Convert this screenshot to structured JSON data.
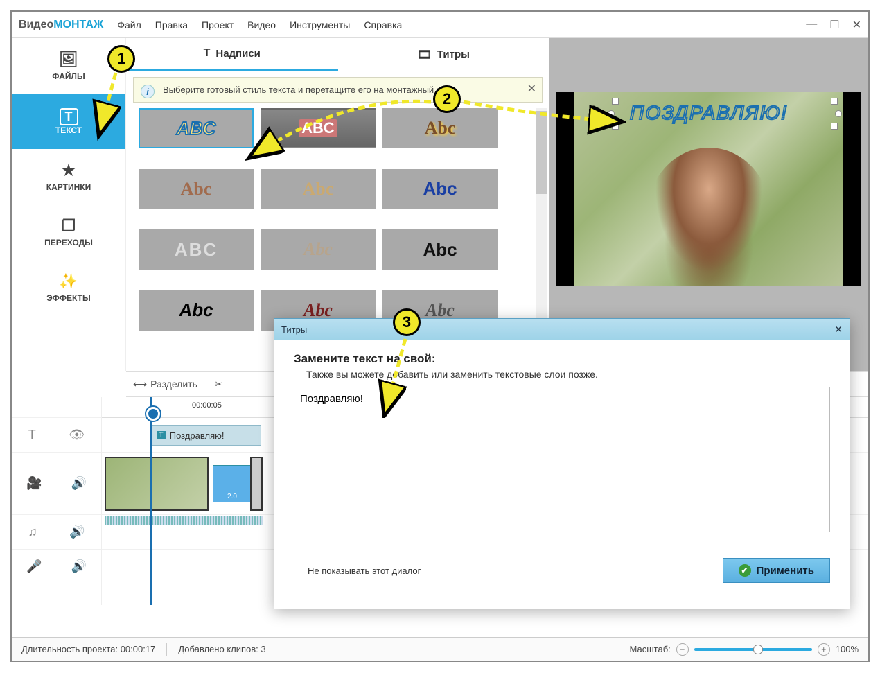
{
  "logo": {
    "part1": "Видео",
    "part2": "МОНТАЖ"
  },
  "menu": [
    "Файл",
    "Правка",
    "Проект",
    "Видео",
    "Инструменты",
    "Справка"
  ],
  "sidebar": {
    "items": [
      {
        "label": "ФАЙЛЫ"
      },
      {
        "label": "ТЕКСТ"
      },
      {
        "label": "КАРТИНКИ"
      },
      {
        "label": "ПЕРЕХОДЫ"
      },
      {
        "label": "ЭФФЕКТЫ"
      }
    ]
  },
  "tabs": {
    "captions": "Надписи",
    "credits": "Титры"
  },
  "info": {
    "text": "Выберите готовый стиль текста и перетащите его на монтажный стол."
  },
  "styles": [
    "ABC",
    "ABC",
    "Abc",
    "Abc",
    "Abc",
    "Abc",
    "ABC",
    "Abc",
    "Abc",
    "Abc",
    "Abc",
    "Abc"
  ],
  "preview": {
    "caption": "ПОЗДРАВЛЯЮ!"
  },
  "toolbar": {
    "split": "Разделить"
  },
  "timeline": {
    "time": "00:00:05",
    "textclip": "Поздравляю!",
    "trans": "2.0"
  },
  "dialog": {
    "title": "Титры",
    "heading": "Замените текст на свой:",
    "sub": "Также вы можете добавить или заменить текстовые слои позже.",
    "value": "Поздравляю!",
    "dontshow": "Не показывать этот диалог",
    "apply": "Применить"
  },
  "status": {
    "duration_label": "Длительность проекта:",
    "duration": "00:00:17",
    "clips_label": "Добавлено клипов:",
    "clips": "3",
    "zoom_label": "Масштаб:",
    "zoom": "100%"
  },
  "badges": {
    "b1": "1",
    "b2": "2",
    "b3": "3"
  }
}
